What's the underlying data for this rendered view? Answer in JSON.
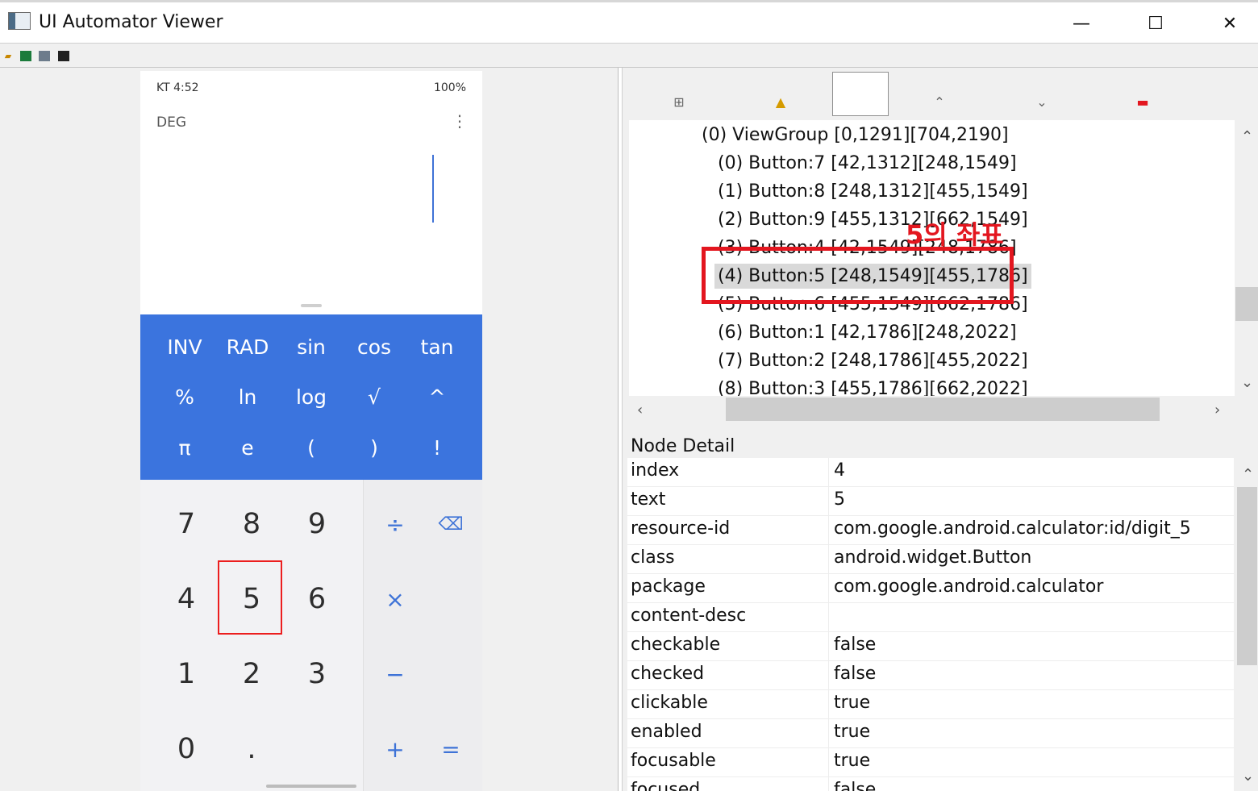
{
  "window": {
    "title": "UI Automator Viewer",
    "controls": [
      "—",
      "☐",
      "✕"
    ]
  },
  "toolbar": {
    "icons": [
      "open-folder-icon",
      "device-screenshot-icon",
      "device-screenshot-compressed-icon",
      "save-icon"
    ]
  },
  "phone": {
    "status_left": "KT 4:52",
    "status_right": "100%",
    "angle_mode": "DEG",
    "menu": "⋮",
    "scientific_keys": [
      [
        "INV",
        "RAD",
        "sin",
        "cos",
        "tan"
      ],
      [
        "%",
        "ln",
        "log",
        "√",
        "^"
      ],
      [
        "π",
        "e",
        "(",
        ")",
        "!"
      ]
    ],
    "digit_keys": [
      [
        "7",
        "8",
        "9"
      ],
      [
        "4",
        "5",
        "6"
      ],
      [
        "1",
        "2",
        "3"
      ],
      [
        "0",
        "."
      ]
    ],
    "operator_keys": [
      "÷",
      "×",
      "−",
      "+"
    ],
    "side_keys": [
      "⌫",
      "="
    ]
  },
  "tree": {
    "rows": [
      "(0) ViewGroup [0,1291][704,2190]",
      "(0) Button:7 [42,1312][248,1549]",
      "(1) Button:8 [248,1312][455,1549]",
      "(2) Button:9 [455,1312][662,1549]",
      "(3) Button:4 [42,1549][248,1786]",
      "(4) Button:5 [248,1549][455,1786]",
      "(5) Button:6 [455,1549][662,1786]",
      "(6) Button:1 [42,1786][248,2022]",
      "(7) Button:2 [248,1786][455,2022]",
      "(8) Button:3 [455,1786][662,2022]"
    ],
    "annotation": "5의 좌표"
  },
  "node_detail": {
    "title": "Node Detail",
    "rows": [
      {
        "key": "index",
        "value": "4"
      },
      {
        "key": "text",
        "value": "5"
      },
      {
        "key": "resource-id",
        "value": "com.google.android.calculator:id/digit_5"
      },
      {
        "key": "class",
        "value": "android.widget.Button"
      },
      {
        "key": "package",
        "value": "com.google.android.calculator"
      },
      {
        "key": "content-desc",
        "value": ""
      },
      {
        "key": "checkable",
        "value": "false"
      },
      {
        "key": "checked",
        "value": "false"
      },
      {
        "key": "clickable",
        "value": "true"
      },
      {
        "key": "enabled",
        "value": "true"
      },
      {
        "key": "focusable",
        "value": "true"
      },
      {
        "key": "focused",
        "value": "false"
      }
    ]
  },
  "colors": {
    "calc_blue": "#3b74de",
    "annotation_red": "#e3161f"
  }
}
